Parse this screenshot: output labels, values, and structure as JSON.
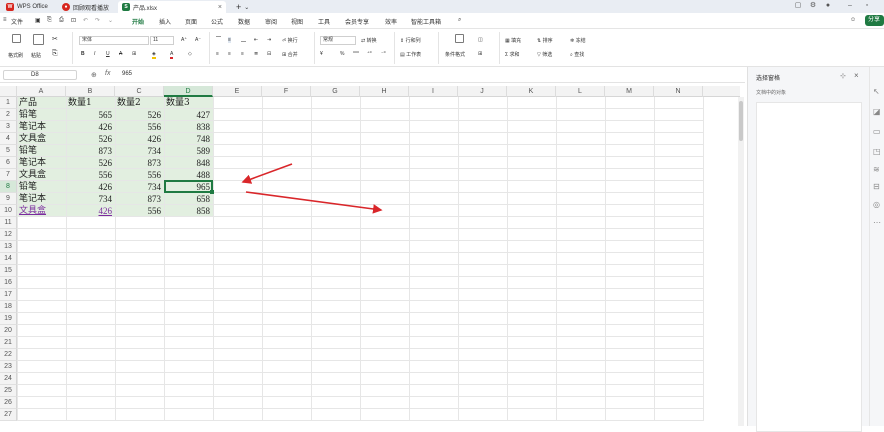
{
  "titlebar": {
    "tabs": [
      {
        "label": "WPS Office",
        "logo": "W",
        "color": "#d7261e"
      },
      {
        "label": "回顾观看播放",
        "logo": "●",
        "color": "#d7261e"
      },
      {
        "label": "产品.xlsx",
        "logo": "S",
        "color": "#1f7a42"
      }
    ],
    "new_tab": "+",
    "tab_chevron": "⌄"
  },
  "menu": {
    "file": "文件",
    "items": [
      "开始",
      "插入",
      "页面",
      "公式",
      "数据",
      "审阅",
      "视图",
      "工具",
      "会员专享",
      "效率",
      "智能工具箱"
    ],
    "share": "分享"
  },
  "ribbon": {
    "format_painter": "格式刷",
    "paste": "粘贴",
    "font_name": "宋体",
    "font_size": "11",
    "wrap": "换行",
    "merge": "合并",
    "number_format": "常规",
    "convert": "转换",
    "row_col": "行和列",
    "worksheet": "工作表",
    "cond_format": "条件格式",
    "fill": "填充",
    "sort": "排序",
    "freeze": "冻结",
    "sum": "求和",
    "filter": "筛选",
    "find": "查找"
  },
  "formula_bar": {
    "name_box": "D8",
    "fx": "fx",
    "value": "965"
  },
  "columns": [
    "A",
    "B",
    "C",
    "D",
    "E",
    "F",
    "G",
    "H",
    "I",
    "J",
    "K",
    "L",
    "M",
    "N"
  ],
  "rows": [
    "1",
    "2",
    "3",
    "4",
    "5",
    "6",
    "7",
    "8",
    "9",
    "10",
    "11",
    "12",
    "13",
    "14",
    "15",
    "16",
    "17",
    "18",
    "19",
    "20",
    "21",
    "22",
    "23",
    "24",
    "25",
    "26",
    "27"
  ],
  "sheet": {
    "headers": [
      "产品",
      "数量1",
      "数量2",
      "数量3"
    ],
    "data": [
      [
        "铅笔",
        "565",
        "526",
        "427"
      ],
      [
        "笔记本",
        "426",
        "556",
        "838"
      ],
      [
        "文具盒",
        "526",
        "426",
        "748"
      ],
      [
        "铅笔",
        "873",
        "734",
        "589"
      ],
      [
        "笔记本",
        "526",
        "873",
        "848"
      ],
      [
        "文具盒",
        "556",
        "556",
        "488"
      ],
      [
        "铅笔",
        "426",
        "734",
        "965"
      ],
      [
        "笔记本",
        "734",
        "873",
        "658"
      ],
      [
        "文具盒",
        "426",
        "556",
        "858"
      ]
    ]
  },
  "pane": {
    "title": "选择窗格",
    "subtitle": "文档中的对象"
  },
  "colors": {
    "accent": "#1f7a42",
    "selection_fill": "#e2efe0",
    "arrow": "#d9262a"
  }
}
